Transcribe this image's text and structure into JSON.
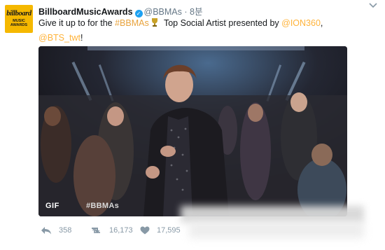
{
  "account": {
    "avatar_line1": "billboard",
    "avatar_line2": "MUSIC AWARDS",
    "name": "BillboardMusicAwards",
    "handle": "@BBMAs",
    "separator": "·",
    "time": "8분"
  },
  "tweet": {
    "text_part1": "Give it up to for the ",
    "hashtag": "#BBMAs",
    "text_part2": " Top Social Artist presented by ",
    "mention1": "@ION360",
    "comma": ",",
    "mention2": "@BTS_twt",
    "exclamation": "!"
  },
  "media": {
    "badge": "GIF",
    "overlay_hashtag": "#BBMAs"
  },
  "actions": {
    "reply_count": "358",
    "retweet_count": "16,173",
    "like_count": "17,595"
  },
  "colors": {
    "link": "#e8a33d",
    "verified": "#1da1f2",
    "brand_yellow": "#f5b800",
    "action_gray": "#8899a6"
  },
  "icons": {
    "caret": "chevron-down-icon",
    "verified": "check-icon",
    "trophy": "trophy-icon",
    "reply": "reply-arrow-icon",
    "retweet": "retweet-icon",
    "like": "heart-icon"
  }
}
